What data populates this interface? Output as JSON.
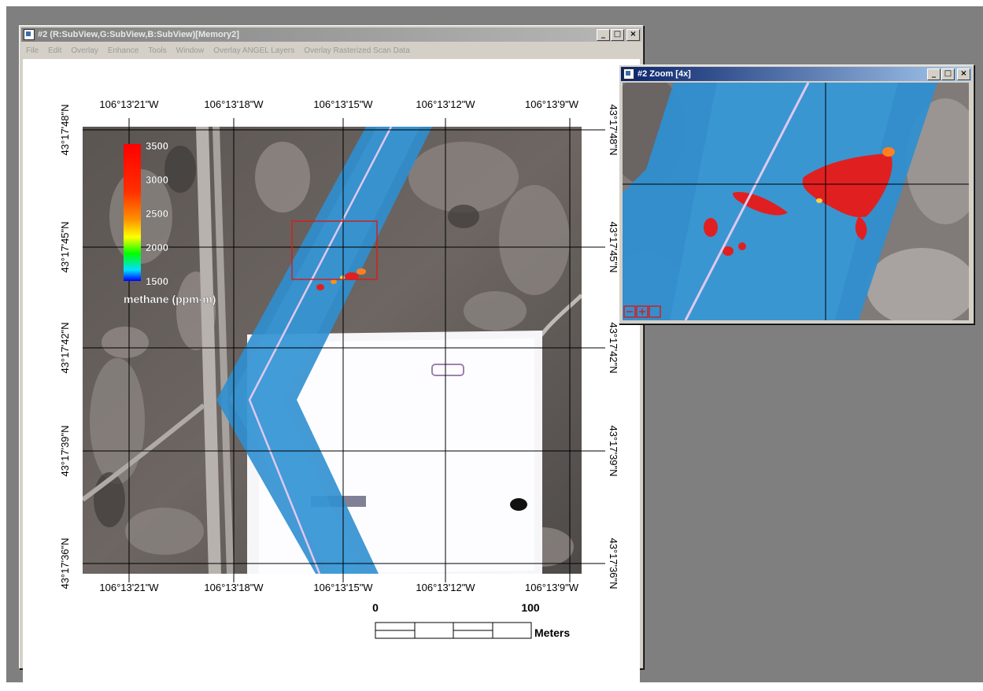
{
  "main_window": {
    "title": "#2 (R:SubView,G:SubView,B:SubView)[Memory2]",
    "menu": [
      "File",
      "Edit",
      "Overlay",
      "Enhance",
      "Tools",
      "Window",
      "Overlay ANGEL Layers",
      "Overlay Rasterized Scan Data"
    ]
  },
  "zoom_window": {
    "title": "#2 Zoom [4x]"
  },
  "window_buttons": {
    "minimize": "_",
    "maximize": "□",
    "close": "×"
  },
  "map": {
    "top_lon_labels": [
      "106°13'21\"W",
      "106°13'18\"W",
      "106°13'15\"W",
      "106°13'12\"W",
      "106°13'9\"W"
    ],
    "bottom_lon_labels": [
      "106°13'21\"W",
      "106°13'18\"W",
      "106°13'15\"W",
      "106°13'12\"W",
      "106°13'9\"W"
    ],
    "left_lat_labels": [
      "43°17'48\"N",
      "43°17'45\"N",
      "43°17'42\"N",
      "43°17'39\"N",
      "43°17'36\"N"
    ],
    "right_lat_labels": [
      "43°17'48\"N",
      "43°17'45\"N",
      "43°17'42\"N",
      "43°17'39\"N",
      "43°17'36\"N"
    ]
  },
  "legend": {
    "title": "methane (ppm-m)",
    "ticks": [
      "3500",
      "3000",
      "2500",
      "2000",
      "1500"
    ],
    "colors": [
      "#ff0000",
      "#ff8000",
      "#ffff00",
      "#00ff00",
      "#00d0ff",
      "#0000ff"
    ]
  },
  "scalebar": {
    "start_label": "0",
    "end_label": "100",
    "unit": "Meters"
  },
  "colors": {
    "plume_blue": "#2f8fd0",
    "plume_high": "#e02020",
    "flight_line": "#e0c8f0",
    "zoom_box": "#d02020"
  }
}
